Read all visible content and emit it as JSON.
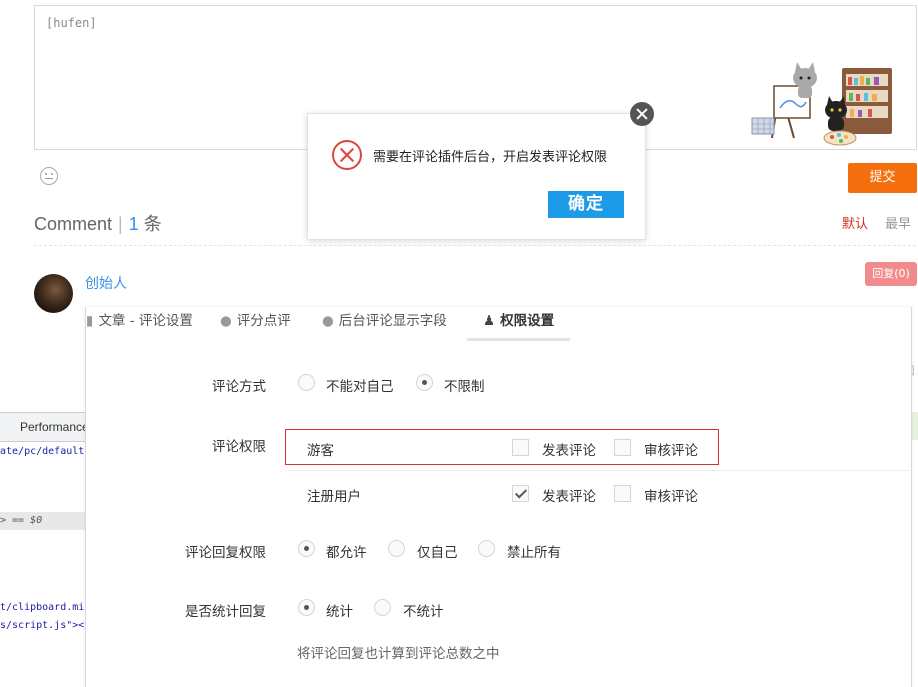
{
  "editor": {
    "placeholder": "[hufen]",
    "illustration": "cat-painting-illustration",
    "emoji_icon": "smiley-icon",
    "submit_label": "提交"
  },
  "comments": {
    "heading_word": "Comment",
    "separator": "|",
    "count": "1",
    "count_unit": "条",
    "sort_default": "默认",
    "sort_latest": "最早",
    "author": "创始人",
    "reply_label": "回复(0)",
    "side_text": "前"
  },
  "devtools": {
    "tab_performance": "Performance",
    "line1": "ate/pc/default",
    "line2": "> == $0",
    "line3": "t/clipboard.min",
    "line4": "s/script.js\"></"
  },
  "settings": {
    "tabs": [
      {
        "label": "文章 - 评论设置",
        "icon": "document-icon"
      },
      {
        "label": "评分点评",
        "icon": "chat-icon"
      },
      {
        "label": "后台评论显示字段",
        "icon": "chat-icon"
      },
      {
        "label": "权限设置",
        "icon": "user-icon",
        "active": true
      }
    ],
    "comment_mode": {
      "label": "评论方式",
      "options": [
        {
          "label": "不能对自己",
          "selected": false
        },
        {
          "label": "不限制",
          "selected": true
        }
      ]
    },
    "comment_permission": {
      "label": "评论权限",
      "rows": [
        {
          "role": "游客",
          "post": {
            "label": "发表评论",
            "checked": false
          },
          "review": {
            "label": "审核评论",
            "checked": false
          }
        },
        {
          "role": "注册用户",
          "post": {
            "label": "发表评论",
            "checked": true
          },
          "review": {
            "label": "审核评论",
            "checked": false
          }
        }
      ]
    },
    "reply_permission": {
      "label": "评论回复权限",
      "options": [
        {
          "label": "都允许",
          "selected": true
        },
        {
          "label": "仅自己",
          "selected": false
        },
        {
          "label": "禁止所有",
          "selected": false
        }
      ]
    },
    "count_replies": {
      "label": "是否统计回复",
      "options": [
        {
          "label": "统计",
          "selected": true
        },
        {
          "label": "不统计",
          "selected": false
        }
      ],
      "hint": "将评论回复也计算到评论总数之中"
    }
  },
  "dialog": {
    "message": "需要在评论插件后台，开启发表评论权限",
    "confirm_label": "确定",
    "colors": {
      "error": "#e0443e",
      "confirm": "#1e9be8"
    }
  }
}
